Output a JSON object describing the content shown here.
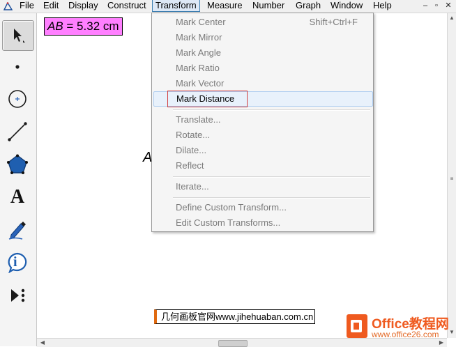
{
  "menubar": {
    "items": [
      {
        "label": "File"
      },
      {
        "label": "Edit"
      },
      {
        "label": "Display"
      },
      {
        "label": "Construct"
      },
      {
        "label": "Transform"
      },
      {
        "label": "Measure"
      },
      {
        "label": "Number"
      },
      {
        "label": "Graph"
      },
      {
        "label": "Window"
      },
      {
        "label": "Help"
      }
    ],
    "active_item": "Transform",
    "window_controls": {
      "minimize": "–",
      "restore": "▫",
      "close": "✕"
    }
  },
  "toolbox": {
    "tools": [
      {
        "name": "arrow-selection-tool",
        "icon": "arrow-icon",
        "selected": true
      },
      {
        "name": "point-tool",
        "icon": "point-icon"
      },
      {
        "name": "compass-tool",
        "icon": "circle-icon"
      },
      {
        "name": "straightedge-tool",
        "icon": "segment-icon"
      },
      {
        "name": "polygon-tool",
        "icon": "polygon-icon"
      },
      {
        "name": "text-tool",
        "icon": "text-a-icon",
        "glyph": "A"
      },
      {
        "name": "marker-tool",
        "icon": "pen-icon"
      },
      {
        "name": "information-tool",
        "icon": "info-icon",
        "glyph": "i"
      },
      {
        "name": "custom-tool",
        "icon": "custom-tool-icon"
      }
    ]
  },
  "canvas": {
    "measurement": {
      "var": "AB",
      "rest": " = 5.32 cm"
    },
    "point_fragment": "A",
    "watermark_caption": "几何画板官网www.jihehuaban.com.cn"
  },
  "transform_menu": {
    "items": [
      {
        "label": "Mark Center",
        "shortcut": "Shift+Ctrl+F",
        "enabled": false
      },
      {
        "label": "Mark Mirror",
        "enabled": false
      },
      {
        "label": "Mark Angle",
        "enabled": false
      },
      {
        "label": "Mark Ratio",
        "enabled": false
      },
      {
        "label": "Mark Vector",
        "enabled": false
      },
      {
        "label": "Mark Distance",
        "enabled": true,
        "highlighted": true
      },
      {
        "label": "Translate...",
        "enabled": false
      },
      {
        "label": "Rotate...",
        "enabled": false
      },
      {
        "label": "Dilate...",
        "enabled": false
      },
      {
        "label": "Reflect",
        "enabled": false
      },
      {
        "label": "Iterate...",
        "enabled": false
      },
      {
        "label": "Define Custom Transform...",
        "enabled": false
      },
      {
        "label": "Edit Custom Transforms...",
        "enabled": false
      }
    ]
  },
  "logo": {
    "text": "Office教程网",
    "url": "www.office26.com"
  },
  "colors": {
    "measurement_bg": "#ff7fff",
    "menu_highlight": "#e8f1fb",
    "highlight_box": "#d23b3b",
    "logo_orange": "#ef5a1f",
    "tool_blue": "#1f5fb0"
  }
}
